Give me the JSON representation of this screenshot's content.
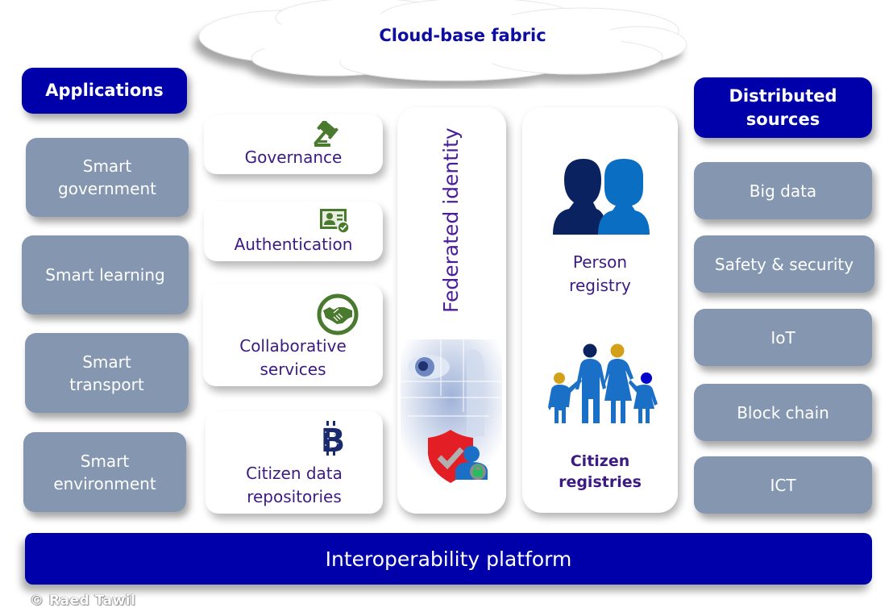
{
  "title": "Cloud-base fabric",
  "applications": {
    "header": "Applications",
    "items": [
      "Smart\ngovernment",
      "Smart learning",
      "Smart\ntransport",
      "Smart\nenvironment"
    ]
  },
  "services": [
    {
      "label": "Governance",
      "icon": "gavel-icon"
    },
    {
      "label": "Authentication",
      "icon": "id-card-check-icon"
    },
    {
      "label": "Collaborative\nservices",
      "icon": "handshake-icon"
    },
    {
      "label": "Citizen data\nrepositories",
      "icon": "bitcoin-icon"
    }
  ],
  "federated_identity": {
    "label": "Federated identity",
    "images": [
      "eye-fingerprint-biometric-image",
      "shield-check-user-lock-icon"
    ]
  },
  "registries": {
    "person": {
      "label": "Person\nregistry",
      "icon": "two-persons-icon"
    },
    "citizen": {
      "label": "Citizen\nregistries",
      "icon": "family-icon"
    }
  },
  "distributed_sources": {
    "header": "Distributed\nsources",
    "items": [
      "Big data",
      "Safety & security",
      "IoT",
      "Block chain",
      "ICT"
    ]
  },
  "platform": "Interoperability platform",
  "copyright": "© Raed Tawil",
  "colors": {
    "header_blue": "#0000aa",
    "gray_box": "#8496b0",
    "label_purple": "#3d1a82",
    "icon_green": "#4a7a2e",
    "person_dark": "#0a2360",
    "person_light": "#0a6fc2",
    "gold": "#d4a017"
  }
}
